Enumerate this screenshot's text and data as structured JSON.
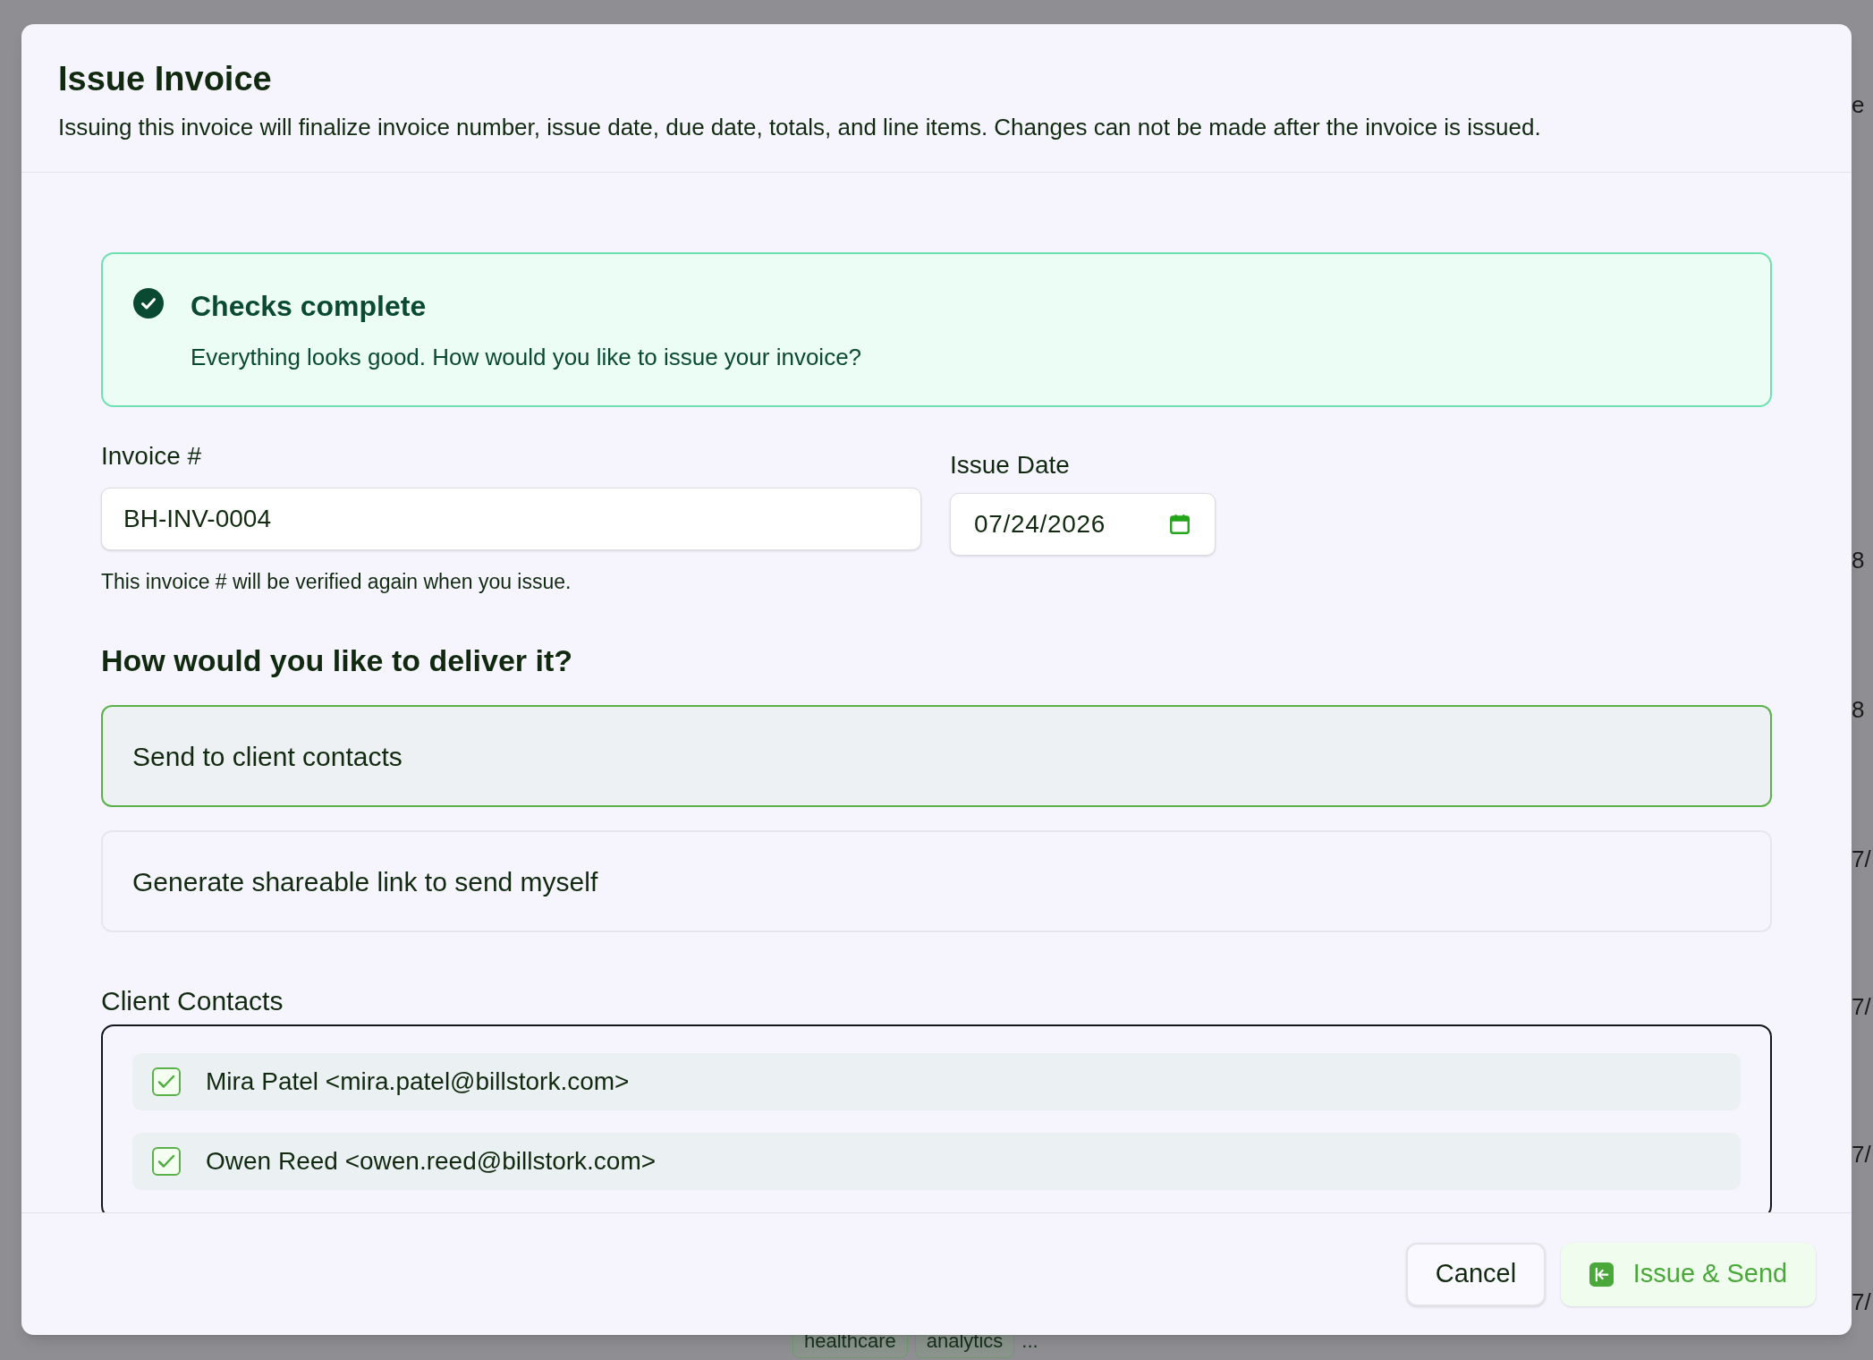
{
  "background": {
    "edge_fragments": [
      "e",
      "8",
      "8",
      "7/",
      "7/",
      "7/",
      "7/"
    ],
    "tags": [
      "healthcare",
      "analytics"
    ],
    "more": "..."
  },
  "dialog": {
    "title": "Issue Invoice",
    "description": "Issuing this invoice will finalize invoice number, issue date, due date, totals, and line items. Changes can not be made after the invoice is issued.",
    "callout": {
      "title": "Checks complete",
      "message": "Everything looks good. How would you like to issue your invoice?"
    },
    "invoice_number": {
      "label": "Invoice #",
      "value": "BH-INV-0004",
      "hint": "This invoice # will be verified again when you issue."
    },
    "issue_date": {
      "label": "Issue Date",
      "value": "07/24/2026"
    },
    "delivery": {
      "heading": "How would you like to deliver it?",
      "options": [
        {
          "label": "Send to client contacts",
          "selected": true
        },
        {
          "label": "Generate shareable link to send myself",
          "selected": false
        }
      ]
    },
    "contacts": {
      "label": "Client Contacts",
      "items": [
        {
          "label": "Mira Patel <mira.patel@billstork.com>",
          "checked": true
        },
        {
          "label": "Owen Reed <owen.reed@billstork.com>",
          "checked": true
        }
      ]
    },
    "buttons": {
      "cancel": "Cancel",
      "primary": "Issue & Send"
    }
  }
}
